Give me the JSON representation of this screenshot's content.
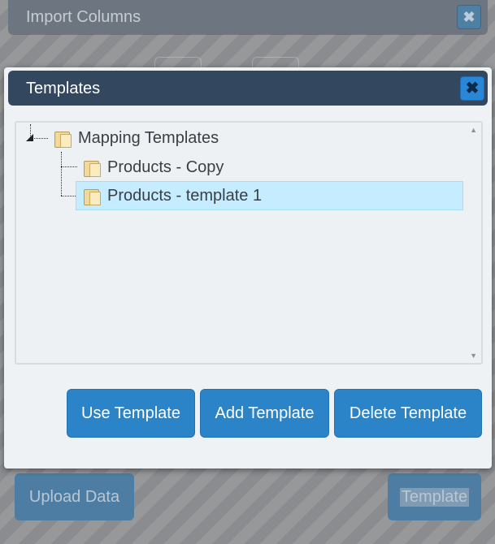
{
  "background_dialog": {
    "title": "Import Columns",
    "close_label": "✖",
    "upload_button_label": "Upload Data",
    "template_button_label": "Template"
  },
  "modal": {
    "title": "Templates",
    "close_label": "✖",
    "tree": {
      "root": {
        "label": "Mapping Templates"
      },
      "children": [
        {
          "label": "Products - Copy",
          "selected": false
        },
        {
          "label": "Products - template 1",
          "selected": true
        }
      ]
    },
    "buttons": {
      "use_label": "Use Template",
      "add_label": "Add Template",
      "delete_label": "Delete Template"
    }
  },
  "colors": {
    "titlebar": "#33475e",
    "accent": "#2b84c8",
    "selection": "#c6ecff"
  },
  "icons": {
    "close": "close-icon",
    "folder": "folder-icon",
    "expander": "expander-triangle-icon",
    "scroll_up": "scroll-up-arrow-icon",
    "scroll_down": "scroll-down-arrow-icon"
  }
}
